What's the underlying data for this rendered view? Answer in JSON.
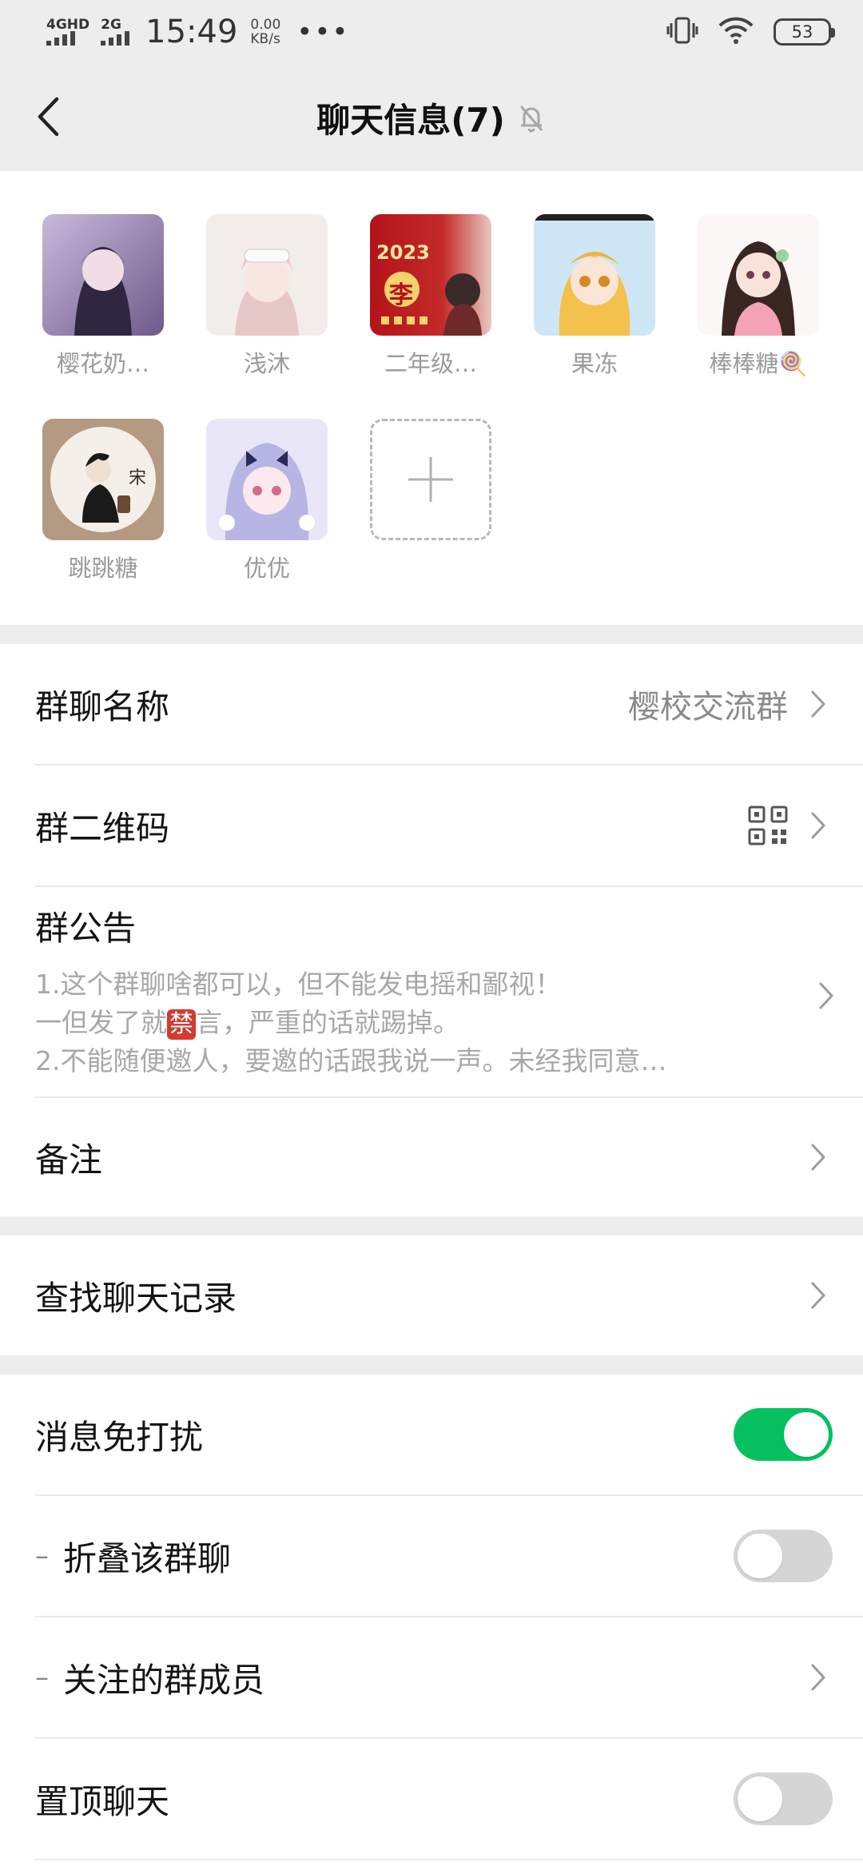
{
  "status_bar": {
    "network_1": "4GHD",
    "network_2": "2G",
    "time": "15:49",
    "speed_value": "0.00",
    "speed_unit": "KB/s",
    "more": "•••",
    "battery": "53"
  },
  "header": {
    "title": "聊天信息(7)",
    "back_icon": "chevron-left-icon",
    "mute_icon": "bell-off-icon"
  },
  "members": [
    {
      "name": "樱花奶…",
      "avatar_color": "#8c7aa8"
    },
    {
      "name": "浅沐",
      "avatar_color": "#e8dcd8"
    },
    {
      "name": "二年级…",
      "avatar_color": "#b01c22",
      "avatar_text_top": "2023",
      "avatar_text_main": "李"
    },
    {
      "name": "果冻",
      "avatar_color": "#c9dff0"
    },
    {
      "name": "棒棒糖🍭",
      "avatar_color": "#f2e6e6"
    },
    {
      "name": "跳跳糖",
      "avatar_color": "#b49a82",
      "avatar_text_main": "宋"
    },
    {
      "name": "优优",
      "avatar_color": "#c8c6e6"
    }
  ],
  "add_member_icon": "plus-icon",
  "group_settings": {
    "group_name_label": "群聊名称",
    "group_name_value": "樱校交流群",
    "qr_label": "群二维码",
    "notice_label": "群公告",
    "notice_line1": "1.这个群聊啥都可以，但不能发电摇和鄙视！",
    "notice_line2_pre": "一但发了就",
    "notice_line2_emoji": "禁",
    "notice_line2_post": "言，严重的话就踢掉。",
    "notice_line3": "2.不能随便邀人，要邀的话跟我说一声。未经我同意…",
    "remark_label": "备注"
  },
  "search_history": {
    "label": "查找聊天记录"
  },
  "message_settings": {
    "mute_label": "消息免打扰",
    "mute_on": true,
    "fold_prefix": "–",
    "fold_label": "折叠该群聊",
    "fold_on": false,
    "followed_prefix": "–",
    "followed_label": "关注的群成员",
    "pin_label": "置顶聊天",
    "pin_on": false
  },
  "colors": {
    "accent_green": "#07c160",
    "background": "#ededed"
  }
}
